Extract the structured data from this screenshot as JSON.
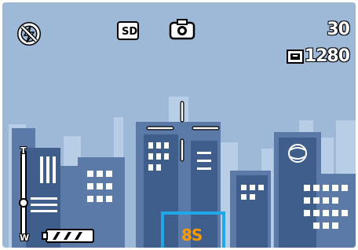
{
  "status": {
    "flash_icon": "flash-off-icon",
    "media_label": "SD",
    "mode_icon": "camera-icon",
    "shots_remaining": "30",
    "resolution_quality_icon": "fine-quality-icon",
    "resolution": "1280"
  },
  "zoom": {
    "tele_label": "T",
    "wide_label": "W",
    "level": 0.4
  },
  "battery": {
    "icon": "battery-icon",
    "level": 1.0
  },
  "self_timer": {
    "label": "8S"
  },
  "focus": {
    "icon": "af-target-icon"
  },
  "colors": {
    "sky": "#9eb8d8",
    "buildings": "#3b5a86",
    "timer_frame": "#1fa8e8",
    "timer_text": "#ff9900"
  }
}
